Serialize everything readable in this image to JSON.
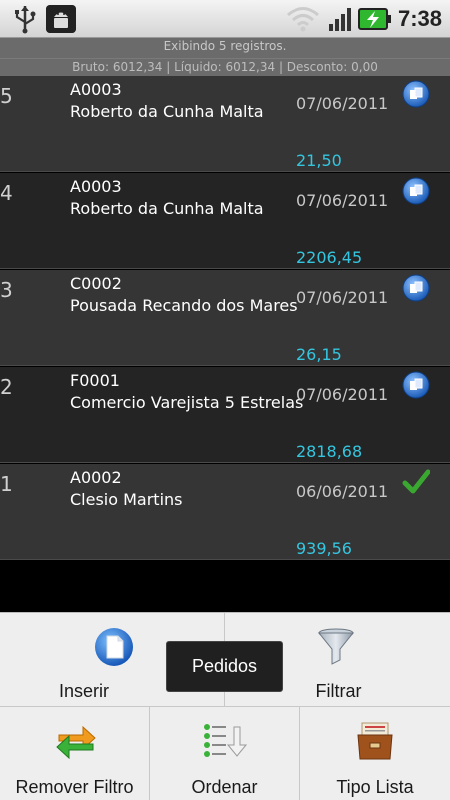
{
  "status_bar": {
    "time": "7:38",
    "icons": [
      "usb-icon",
      "android-debug-icon",
      "wifi-icon",
      "signal-icon",
      "battery-charging-icon"
    ]
  },
  "summary": {
    "records": "Exibindo 5 registros.",
    "totals": "Bruto: 6012,34 | Líquido: 6012,34 | Desconto: 0,00"
  },
  "rows": [
    {
      "num": "5",
      "code": "A0003",
      "name": "Roberto da Cunha Malta",
      "date": "07/06/2011",
      "value": "21,50",
      "status_icon": "sync-pending-icon"
    },
    {
      "num": "4",
      "code": "A0003",
      "name": "Roberto da Cunha Malta",
      "date": "07/06/2011",
      "value": "2206,45",
      "status_icon": "sync-pending-icon"
    },
    {
      "num": "3",
      "code": "C0002",
      "name": "Pousada Recando dos Mares",
      "date": "07/06/2011",
      "value": "26,15",
      "status_icon": "sync-pending-icon"
    },
    {
      "num": "2",
      "code": "F0001",
      "name": "Comercio Varejista 5 Estrelas",
      "date": "07/06/2011",
      "value": "2818,68",
      "status_icon": "sync-pending-icon"
    },
    {
      "num": "1",
      "code": "A0002",
      "name": "Clesio Martins",
      "date": "06/06/2011",
      "value": "939,56",
      "status_icon": "check-icon"
    }
  ],
  "menu": {
    "insert": "Inserir",
    "filter": "Filtrar",
    "remove_filter": "Remover Filtro",
    "order": "Ordenar",
    "list_type": "Tipo Lista"
  },
  "toast": "Pedidos",
  "colors": {
    "value_text": "#34c6e0",
    "row_odd": "#353535",
    "row_even": "#242424",
    "check": "#3aa830",
    "sync_icon": "#2a6fc9"
  }
}
